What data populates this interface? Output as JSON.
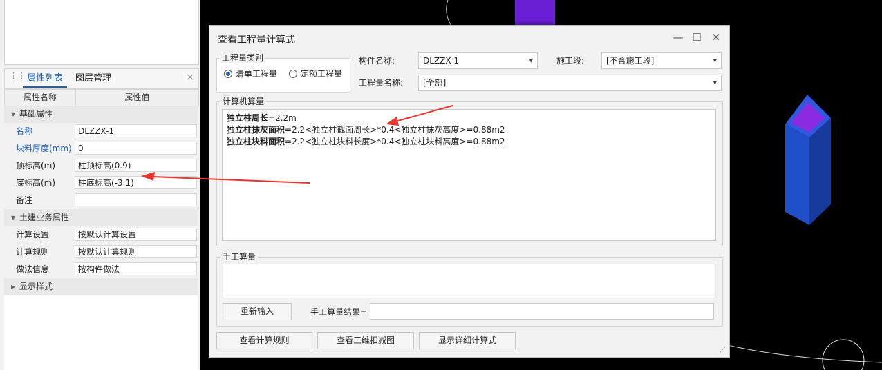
{
  "left_panel": {
    "tabs": [
      "属性列表",
      "图层管理"
    ],
    "close_glyph": "×",
    "columns": [
      "属性名称",
      "属性值"
    ],
    "sections": [
      {
        "label": "基础属性",
        "expanded": true
      },
      {
        "label": "土建业务属性",
        "expanded": true
      },
      {
        "label": "显示样式",
        "expanded": false
      }
    ],
    "rows": [
      {
        "name": "名称",
        "value": "DLZZX-1"
      },
      {
        "name": "块料厚度(mm)",
        "value": "0"
      },
      {
        "name": "顶标高(m)",
        "value": "柱顶标高(0.9)"
      },
      {
        "name": "底标高(m)",
        "value": "柱底标高(-3.1)"
      },
      {
        "name": "备注",
        "value": ""
      },
      {
        "name": "计算设置",
        "value": "按默认计算设置"
      },
      {
        "name": "计算规则",
        "value": "按默认计算规则"
      },
      {
        "name": "做法信息",
        "value": "按构件做法"
      }
    ]
  },
  "dialog": {
    "title": "查看工程量计算式",
    "window_buttons": [
      "minimize-icon",
      "maximize-icon",
      "close-icon"
    ],
    "qty_type_group": {
      "label": "工程量类别",
      "options": [
        "清单工程量",
        "定额工程量"
      ],
      "selected": "清单工程量"
    },
    "component_label": "构件名称:",
    "component_value": "DLZZX-1",
    "stage_label": "施工段:",
    "stage_value": "[不含施工段]",
    "qty_name_label": "工程量名称:",
    "qty_name_value": "[全部]",
    "computer_calc": {
      "label": "计算机算量",
      "lines": [
        {
          "name": "独立柱周长",
          "formula": "=2.2m"
        },
        {
          "name": "独立柱抹灰面积",
          "formula": "=2.2<独立柱截面周长>*0.4<独立柱抹灰高度>=0.88m2"
        },
        {
          "name": "独立柱块料面积",
          "formula": "=2.2<独立柱块料长度>*0.4<独立柱块料高度>=0.88m2"
        }
      ]
    },
    "manual_calc": {
      "label": "手工算量",
      "reenter_button": "重新输入",
      "result_label": "手工算量结果=",
      "result_value": ""
    },
    "footer_buttons": [
      "查看计算规则",
      "查看三维扣减图",
      "显示详细计算式"
    ]
  },
  "colors": {
    "accent": "#1a5fb4",
    "annotation_arrow": "#e8352e",
    "column_blue": "#1f48c8",
    "column_top": "#8a2be2"
  }
}
